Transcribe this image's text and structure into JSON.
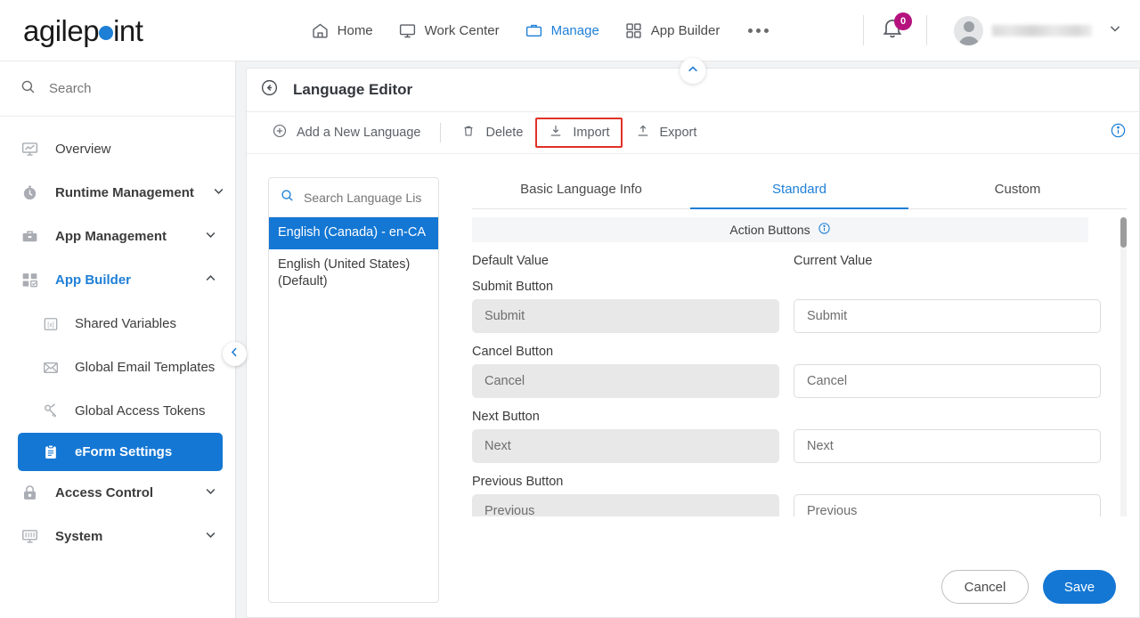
{
  "brand": {
    "name_a": "agilep",
    "name_b": "int",
    "dot_icon": "circle-dot",
    "accent": "#1e7fd6"
  },
  "topnav": {
    "items": [
      {
        "label": "Home",
        "icon": "home-icon",
        "active": false
      },
      {
        "label": "Work Center",
        "icon": "monitor-icon",
        "active": false
      },
      {
        "label": "Manage",
        "icon": "briefcase-icon",
        "active": true
      },
      {
        "label": "App Builder",
        "icon": "grid-icon",
        "active": false
      }
    ],
    "more_icon": "ellipsis-icon",
    "notifications": {
      "icon": "bell-icon",
      "count": "0",
      "badge_color": "#b5127e"
    },
    "account": {
      "icon": "avatar-icon",
      "name": "",
      "caret": "chevron-down-icon"
    }
  },
  "sidebar": {
    "search": {
      "icon": "search-icon",
      "placeholder": "Search",
      "value": ""
    },
    "collapse_icon": "chevron-left-icon",
    "items": [
      {
        "label": "Overview",
        "icon": "overview-icon",
        "level": 0,
        "chevron": "",
        "state": ""
      },
      {
        "label": "Runtime Management",
        "icon": "clock-icon",
        "level": 0,
        "chevron": "chevron-down-icon",
        "state": ""
      },
      {
        "label": "App Management",
        "icon": "briefcase-icon",
        "level": 0,
        "chevron": "chevron-down-icon",
        "state": ""
      },
      {
        "label": "App Builder",
        "icon": "grid-check-icon",
        "level": 0,
        "chevron": "chevron-up-icon",
        "state": "accent"
      },
      {
        "label": "Shared Variables",
        "icon": "variable-icon",
        "level": 1,
        "chevron": "",
        "state": ""
      },
      {
        "label": "Global Email Templates",
        "icon": "envelope-icon",
        "level": 1,
        "chevron": "",
        "state": ""
      },
      {
        "label": "Global Access Tokens",
        "icon": "key-icon",
        "level": 1,
        "chevron": "",
        "state": ""
      },
      {
        "label": "eForm Settings",
        "icon": "clipboard-icon",
        "level": 1,
        "chevron": "",
        "state": "selected"
      },
      {
        "label": "Access Control",
        "icon": "lock-icon",
        "level": 0,
        "chevron": "chevron-down-icon",
        "state": ""
      },
      {
        "label": "System",
        "icon": "system-icon",
        "level": 0,
        "chevron": "chevron-down-icon",
        "state": ""
      }
    ]
  },
  "panel": {
    "pull_tab_icon": "chevron-up-icon",
    "back_icon": "arrow-left-circle-icon",
    "title": "Language Editor",
    "toolbar": {
      "add_label": "Add a New Language",
      "add_icon": "plus-circle-icon",
      "delete_label": "Delete",
      "delete_icon": "trash-icon",
      "import_label": "Import",
      "import_icon": "download-icon",
      "import_highlight_color": "#e03226",
      "export_label": "Export",
      "export_icon": "upload-icon",
      "info_icon": "info-circle-icon"
    }
  },
  "language_list": {
    "search": {
      "icon": "search-icon",
      "placeholder": "Search Language Lis",
      "value": ""
    },
    "items": [
      {
        "label": "English (Canada) - en-CA",
        "selected": true
      },
      {
        "label": "English (United States) (Default)",
        "selected": false
      }
    ]
  },
  "form": {
    "tabs": [
      {
        "label": "Basic Language Info",
        "active": false
      },
      {
        "label": "Standard",
        "active": true
      },
      {
        "label": "Custom",
        "active": false
      }
    ],
    "section": {
      "title": "Action Buttons",
      "info_icon": "info-circle-icon"
    },
    "columns": {
      "default": "Default Value",
      "current": "Current Value"
    },
    "rows": [
      {
        "label": "Submit Button",
        "default_value": "Submit",
        "current_value": "Submit"
      },
      {
        "label": "Cancel Button",
        "default_value": "Cancel",
        "current_value": "Cancel"
      },
      {
        "label": "Next Button",
        "default_value": "Next",
        "current_value": "Next"
      },
      {
        "label": "Previous Button",
        "default_value": "Previous",
        "current_value": "Previous"
      }
    ],
    "scrollbar": {
      "position": "top"
    },
    "footer": {
      "cancel_label": "Cancel",
      "save_label": "Save",
      "save_color": "#1477d4"
    }
  }
}
